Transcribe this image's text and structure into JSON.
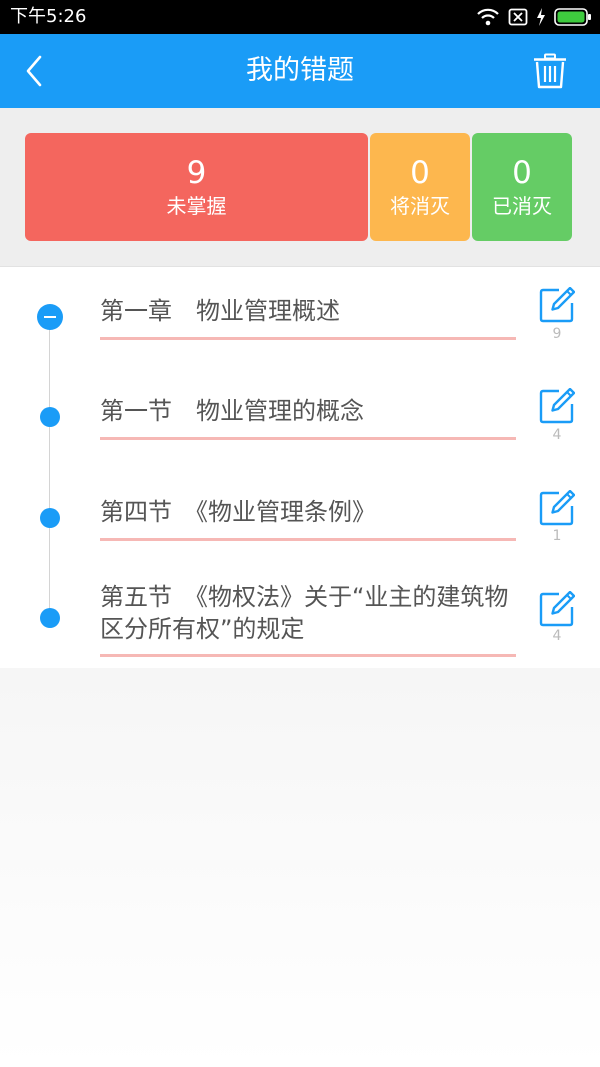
{
  "status_bar": {
    "time": "下午5:26"
  },
  "header": {
    "title": "我的错题",
    "back_icon": "chevron-left-icon",
    "delete_icon": "trash-icon"
  },
  "summary": {
    "unmastered": {
      "value": "9",
      "label": "未掌握",
      "color": "#f4665e"
    },
    "fading": {
      "value": "0",
      "label": "将消灭",
      "color": "#fdb74e"
    },
    "eliminated": {
      "value": "0",
      "label": "已消灭",
      "color": "#65cc65"
    }
  },
  "chapters": [
    {
      "title": "第一章　物业管理概述",
      "count": "9",
      "expanded": true
    },
    {
      "title": "第一节　物业管理的概念",
      "count": "4"
    },
    {
      "title": "第四节　《物业管理条例》",
      "count": "1"
    },
    {
      "title": "第五节　《物权法》关于“业主的建筑物区分所有权”的规定",
      "count": "4"
    }
  ],
  "colors": {
    "primary": "#1a9cf7",
    "underline": "#f6b8b5"
  }
}
